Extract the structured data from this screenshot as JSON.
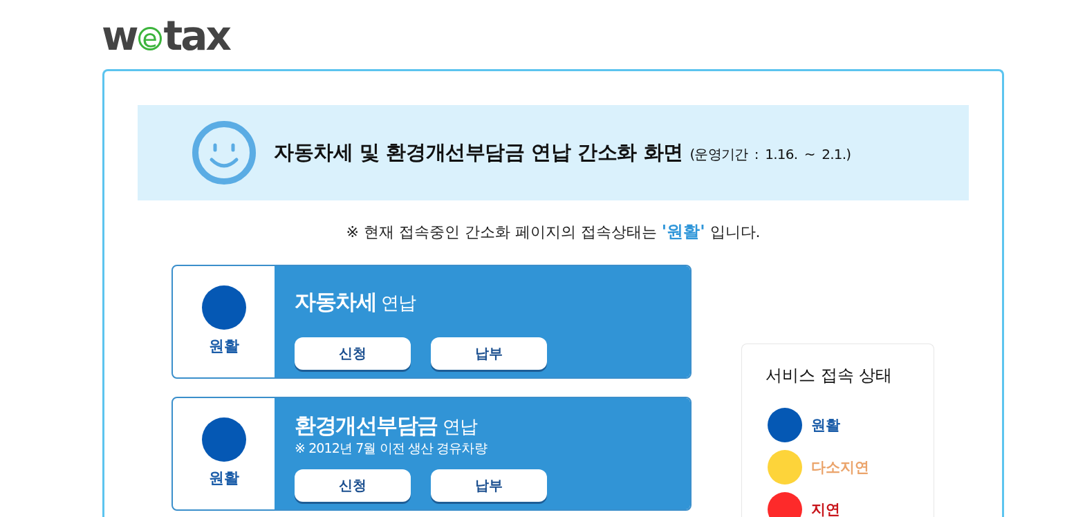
{
  "logo": {
    "text": "wetax"
  },
  "banner": {
    "title": "**자동차세 및 환경개선부담금 연납 간소화 화면** (운영기간 : 1.16. ~ 2.1.)"
  },
  "notice": "※ 현재 접속중인 간소화 페이지의 접속상태는 **'원활'** 입니다.",
  "services": [
    {
      "status": {
        "label": "원활",
        "kind": "smooth",
        "color": "#0558b4"
      },
      "title": "**자동차세** 연납",
      "buttons": [
        "신청",
        "납부"
      ]
    },
    {
      "status": {
        "label": "원활",
        "kind": "smooth",
        "color": "#0558b4"
      },
      "title": "**환경개선부담금** 연납",
      "note": "※ 2012년 7월 이전 생산 경유차량",
      "buttons": [
        "신청",
        "납부"
      ]
    }
  ],
  "legend": {
    "title": "서비스 접속 상태",
    "items": [
      {
        "label": "원활",
        "kind": "smooth",
        "color": "#0558b4"
      },
      {
        "label": "다소지연",
        "kind": "slow",
        "color": "#fdd43a"
      },
      {
        "label": "지연",
        "kind": "delay",
        "color": "#fd2a2a"
      }
    ]
  }
}
